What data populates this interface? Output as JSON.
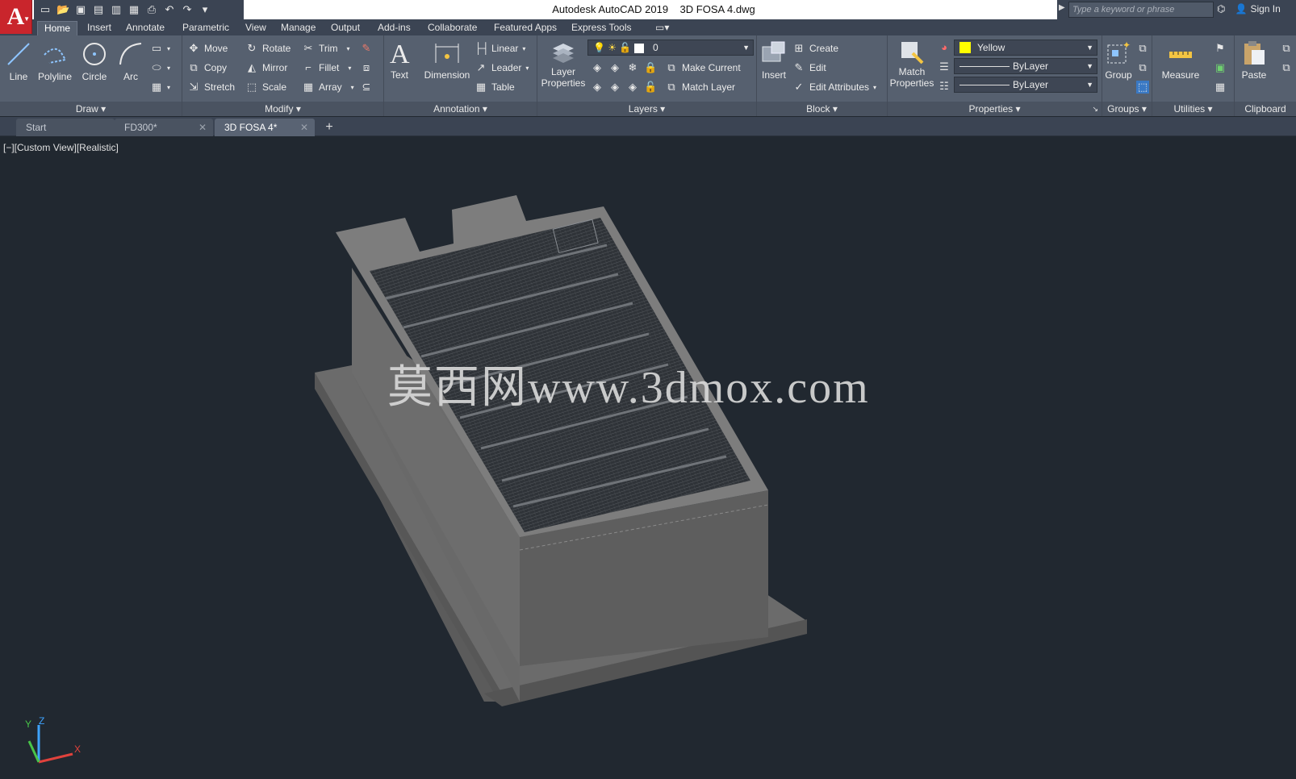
{
  "window": {
    "app_name": "Autodesk AutoCAD 2019",
    "file_name": "3D FOSA 4.dwg"
  },
  "app_logo": "A",
  "search": {
    "placeholder": "Type a keyword or phrase"
  },
  "user": {
    "signin_label": "Sign In"
  },
  "ribbon_tabs": [
    "Home",
    "Insert",
    "Annotate",
    "Parametric",
    "View",
    "Manage",
    "Output",
    "Add-ins",
    "Collaborate",
    "Featured Apps",
    "Express Tools"
  ],
  "ribbon": {
    "draw": {
      "label": "Draw",
      "line": "Line",
      "polyline": "Polyline",
      "circle": "Circle",
      "arc": "Arc"
    },
    "modify": {
      "label": "Modify",
      "move": "Move",
      "rotate": "Rotate",
      "trim": "Trim",
      "copy": "Copy",
      "mirror": "Mirror",
      "fillet": "Fillet",
      "stretch": "Stretch",
      "scale": "Scale",
      "array": "Array"
    },
    "annotation": {
      "label": "Annotation",
      "text": "Text",
      "dimension": "Dimension",
      "linear": "Linear",
      "leader": "Leader",
      "table": "Table"
    },
    "layers": {
      "label": "Layers",
      "layer_properties_1": "Layer",
      "layer_properties_2": "Properties",
      "current_layer": "0",
      "make_current": "Make Current",
      "match_layer": "Match Layer"
    },
    "block": {
      "label": "Block",
      "insert": "Insert",
      "create": "Create",
      "edit": "Edit",
      "edit_attributes": "Edit Attributes"
    },
    "properties": {
      "label": "Properties",
      "match_1": "Match",
      "match_2": "Properties",
      "color": "Yellow",
      "color_hex": "#ffff00",
      "linetype": "ByLayer",
      "lineweight": "ByLayer"
    },
    "groups": {
      "label": "Groups",
      "group": "Group"
    },
    "utilities": {
      "label": "Utilities",
      "measure": "Measure"
    },
    "clipboard": {
      "label": "Clipboard",
      "paste": "Paste"
    }
  },
  "file_tabs": [
    {
      "label": "Start"
    },
    {
      "label": "FD300*"
    },
    {
      "label": "3D FOSA 4*"
    }
  ],
  "viewport": {
    "label": "[−][Custom View][Realistic]",
    "watermark": "莫西网www.3dmox.com",
    "ucs": {
      "x": "X",
      "y": "Y",
      "z": "Z"
    }
  },
  "colors": {
    "viewport_bg": "#212830",
    "ribbon_bg": "#56606f",
    "accent_red": "#c9252c"
  }
}
